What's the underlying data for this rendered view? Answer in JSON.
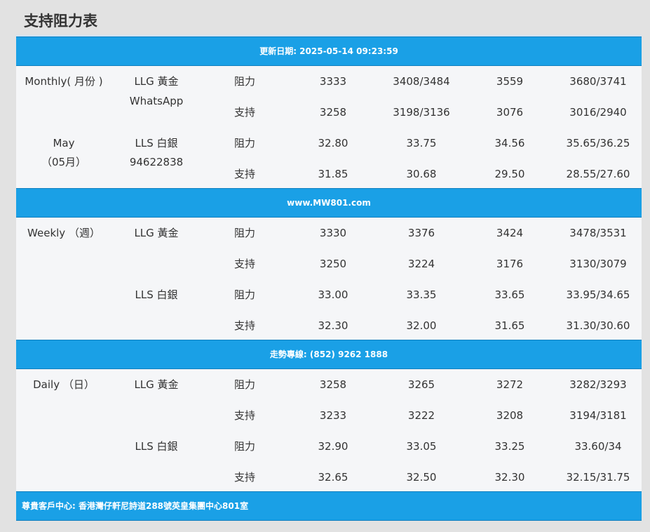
{
  "page_title": "支持阻力表",
  "header_bar": "更新日期: 2025-05-14 09:23:59",
  "mid_bar_1": "www.MW801.com",
  "mid_bar_2": "走勢專線: (852) 9262 1888",
  "footer_bar": "尊貴客戶中心: 香港灣仔軒尼詩道288號英皇集團中心801室",
  "sections": [
    {
      "period_line1": "Monthly( 月份 )",
      "period_line2": "",
      "period_line3": "May",
      "period_line4": "（05月）",
      "gold_label": "LLG 黃金",
      "gold_sub": "WhatsApp",
      "silver_label": "LLS 白銀",
      "silver_sub": "94622838",
      "rows": [
        {
          "type": "阻力",
          "v1": "3333",
          "v2": "3408/3484",
          "v3": "3559",
          "v4": "3680/3741"
        },
        {
          "type": "支持",
          "v1": "3258",
          "v2": "3198/3136",
          "v3": "3076",
          "v4": "3016/2940"
        },
        {
          "type": "阻力",
          "v1": "32.80",
          "v2": "33.75",
          "v3": "34.56",
          "v4": "35.65/36.25"
        },
        {
          "type": "支持",
          "v1": "31.85",
          "v2": "30.68",
          "v3": "29.50",
          "v4": "28.55/27.60"
        }
      ]
    },
    {
      "period_line1": "Weekly （週）",
      "gold_label": "LLG 黃金",
      "silver_label": "LLS 白銀",
      "rows": [
        {
          "type": "阻力",
          "v1": "3330",
          "v2": "3376",
          "v3": "3424",
          "v4": "3478/3531"
        },
        {
          "type": "支持",
          "v1": "3250",
          "v2": "3224",
          "v3": "3176",
          "v4": "3130/3079"
        },
        {
          "type": "阻力",
          "v1": "33.00",
          "v2": "33.35",
          "v3": "33.65",
          "v4": "33.95/34.65"
        },
        {
          "type": "支持",
          "v1": "32.30",
          "v2": "32.00",
          "v3": "31.65",
          "v4": "31.30/30.60"
        }
      ]
    },
    {
      "period_line1": "Daily （日）",
      "gold_label": "LLG 黃金",
      "silver_label": "LLS 白銀",
      "rows": [
        {
          "type": "阻力",
          "v1": "3258",
          "v2": "3265",
          "v3": "3272",
          "v4": "3282/3293"
        },
        {
          "type": "支持",
          "v1": "3233",
          "v2": "3222",
          "v3": "3208",
          "v4": "3194/3181"
        },
        {
          "type": "阻力",
          "v1": "32.90",
          "v2": "33.05",
          "v3": "33.25",
          "v4": "33.60/34"
        },
        {
          "type": "支持",
          "v1": "32.65",
          "v2": "32.50",
          "v3": "32.30",
          "v4": "32.15/31.75"
        }
      ]
    }
  ]
}
